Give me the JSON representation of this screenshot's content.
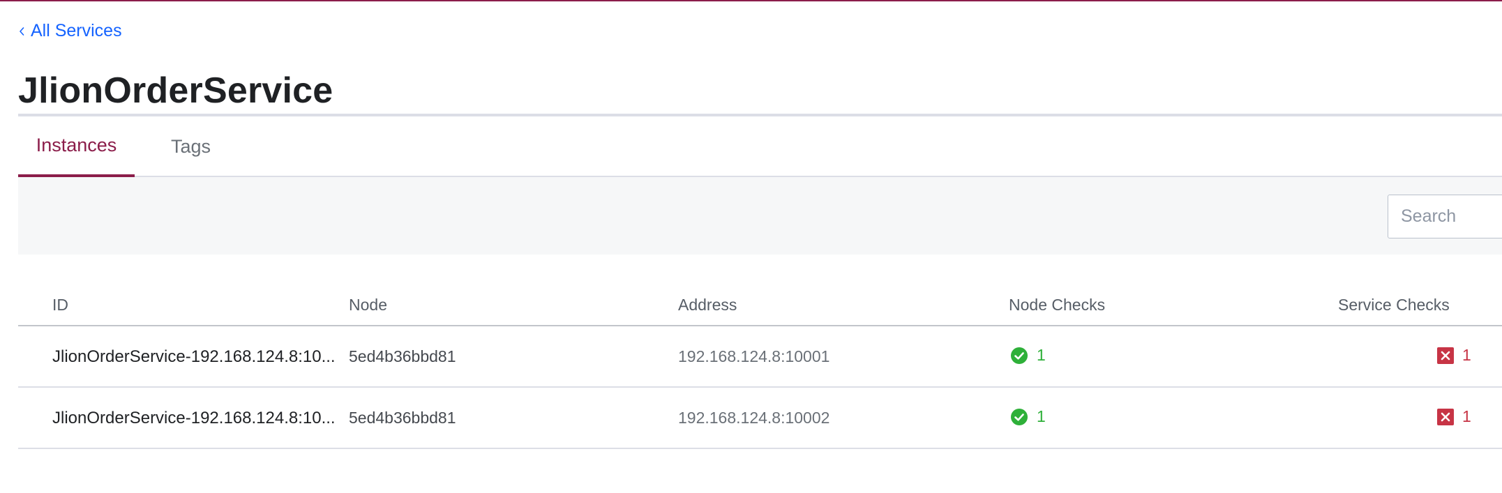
{
  "breadcrumb": {
    "label": "All Services"
  },
  "page": {
    "title": "JlionOrderService"
  },
  "tabs": [
    {
      "label": "Instances",
      "active": true
    },
    {
      "label": "Tags",
      "active": false
    }
  ],
  "search": {
    "placeholder": "Search",
    "value": ""
  },
  "table": {
    "columns": [
      "ID",
      "Node",
      "Address",
      "Node Checks",
      "Service Checks"
    ],
    "rows": [
      {
        "id": "JlionOrderService-192.168.124.8:10...",
        "node": "5ed4b36bbd81",
        "address": "192.168.124.8:10001",
        "node_checks": "1",
        "service_checks": "1"
      },
      {
        "id": "JlionOrderService-192.168.124.8:10...",
        "node": "5ed4b36bbd81",
        "address": "192.168.124.8:10002",
        "node_checks": "1",
        "service_checks": "1"
      }
    ]
  },
  "colors": {
    "accent": "#8b1d4a",
    "link": "#1563ff",
    "passing": "#2eb039",
    "failing": "#c73445"
  },
  "icons": {
    "back": "chevron-left-icon",
    "passing": "check-circle-icon",
    "failing": "x-square-icon"
  }
}
